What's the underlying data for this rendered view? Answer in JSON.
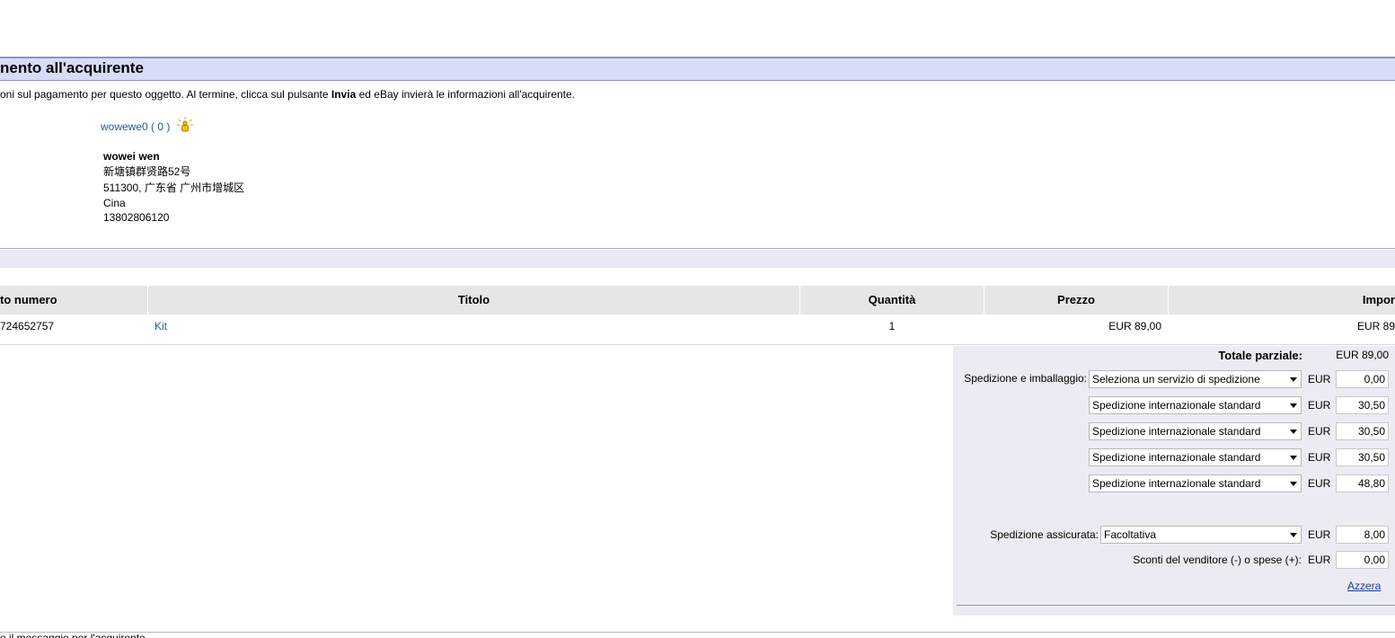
{
  "section": {
    "title": "nento all'acquirente",
    "intro_pre": "oni sul pagamento per questo oggetto. Al termine, clicca sul pulsante ",
    "intro_bold": "Invia",
    "intro_post": " ed eBay invierà le informazioni all'acquirente."
  },
  "buyer": {
    "username": "wowewe0",
    "score": "( 0 )",
    "name": "wowei wen",
    "street": "新塘镇群贤路52号",
    "city": "511300, 广东省 广州市增城区",
    "country": "Cina",
    "phone": "13802806120"
  },
  "table": {
    "headers": {
      "item_number": "to numero",
      "title": "Titolo",
      "quantity": "Quantità",
      "price": "Prezzo",
      "amount": "Impor"
    },
    "rows": [
      {
        "item_number": "724652757",
        "title": "Kit",
        "quantity": "1",
        "price": "EUR 89,00",
        "amount": "EUR 89"
      }
    ]
  },
  "totals": {
    "subtotal_label": "Totale parziale:",
    "subtotal_value": "EUR 89,00",
    "shipping_label": "Spedizione e imballaggio:",
    "currency": "EUR",
    "shipping_rows": [
      {
        "service": "Seleziona un servizio di spedizione",
        "amount": "0,00"
      },
      {
        "service": "Spedizione internazionale standard",
        "amount": "30,50"
      },
      {
        "service": "Spedizione internazionale standard",
        "amount": "30,50"
      },
      {
        "service": "Spedizione internazionale standard",
        "amount": "30,50"
      },
      {
        "service": "Spedizione internazionale standard",
        "amount": "48,80"
      }
    ],
    "insurance_label": "Spedizione assicurata:",
    "insurance_option": "Facoltativa",
    "insurance_amount": "8,00",
    "discount_label": "Sconti del venditore (-) o spese (+):",
    "discount_amount": "0,00",
    "reset_label": "Azzera"
  },
  "footer_text": "e il messaggio per l'acquirente"
}
